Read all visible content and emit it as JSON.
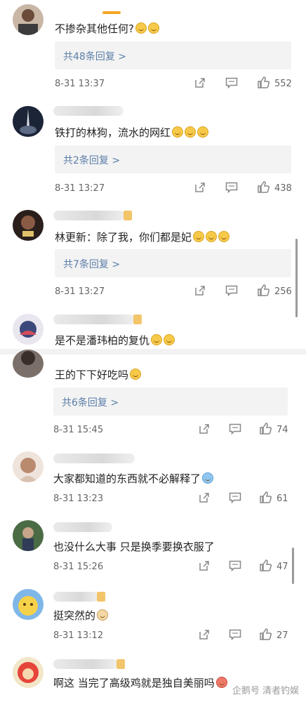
{
  "comments": [
    {
      "text": "不掺杂其他任何?",
      "replies": "共48条回复 >",
      "time": "8-31 13:37",
      "likes": "552"
    },
    {
      "text": "铁打的林狗，流水的网红",
      "replies": "共2条回复 >",
      "time": "8-31 13:27",
      "likes": "438"
    },
    {
      "text": "林更新：除了我，你们都是妃",
      "replies": "共7条回复 >",
      "time": "8-31 13:27",
      "likes": "256"
    },
    {
      "text": "是不是潘玮柏的复仇"
    },
    {
      "text": "王的下下好吃吗",
      "replies": "共6条回复 >",
      "time": "8-31 15:45",
      "likes": "74"
    },
    {
      "text": "大家都知道的东西就不必解释了",
      "time": "8-31 13:23",
      "likes": "61"
    },
    {
      "text": "也没什么大事 只是换季要换衣服了",
      "time": "8-31 15:26",
      "likes": "47"
    },
    {
      "text": "挺突然的",
      "time": "8-31 13:12",
      "likes": "27"
    },
    {
      "text": "啊这 当完了高级鸡就是独自美丽吗"
    }
  ],
  "watermark": "企鹅号 清者钓娱",
  "icons": [
    "share-icon",
    "comment-icon",
    "like-icon"
  ],
  "colors": {
    "link": "#5b7ea8",
    "replyBg": "#f3f3f3",
    "badge": "#f3c56b"
  }
}
